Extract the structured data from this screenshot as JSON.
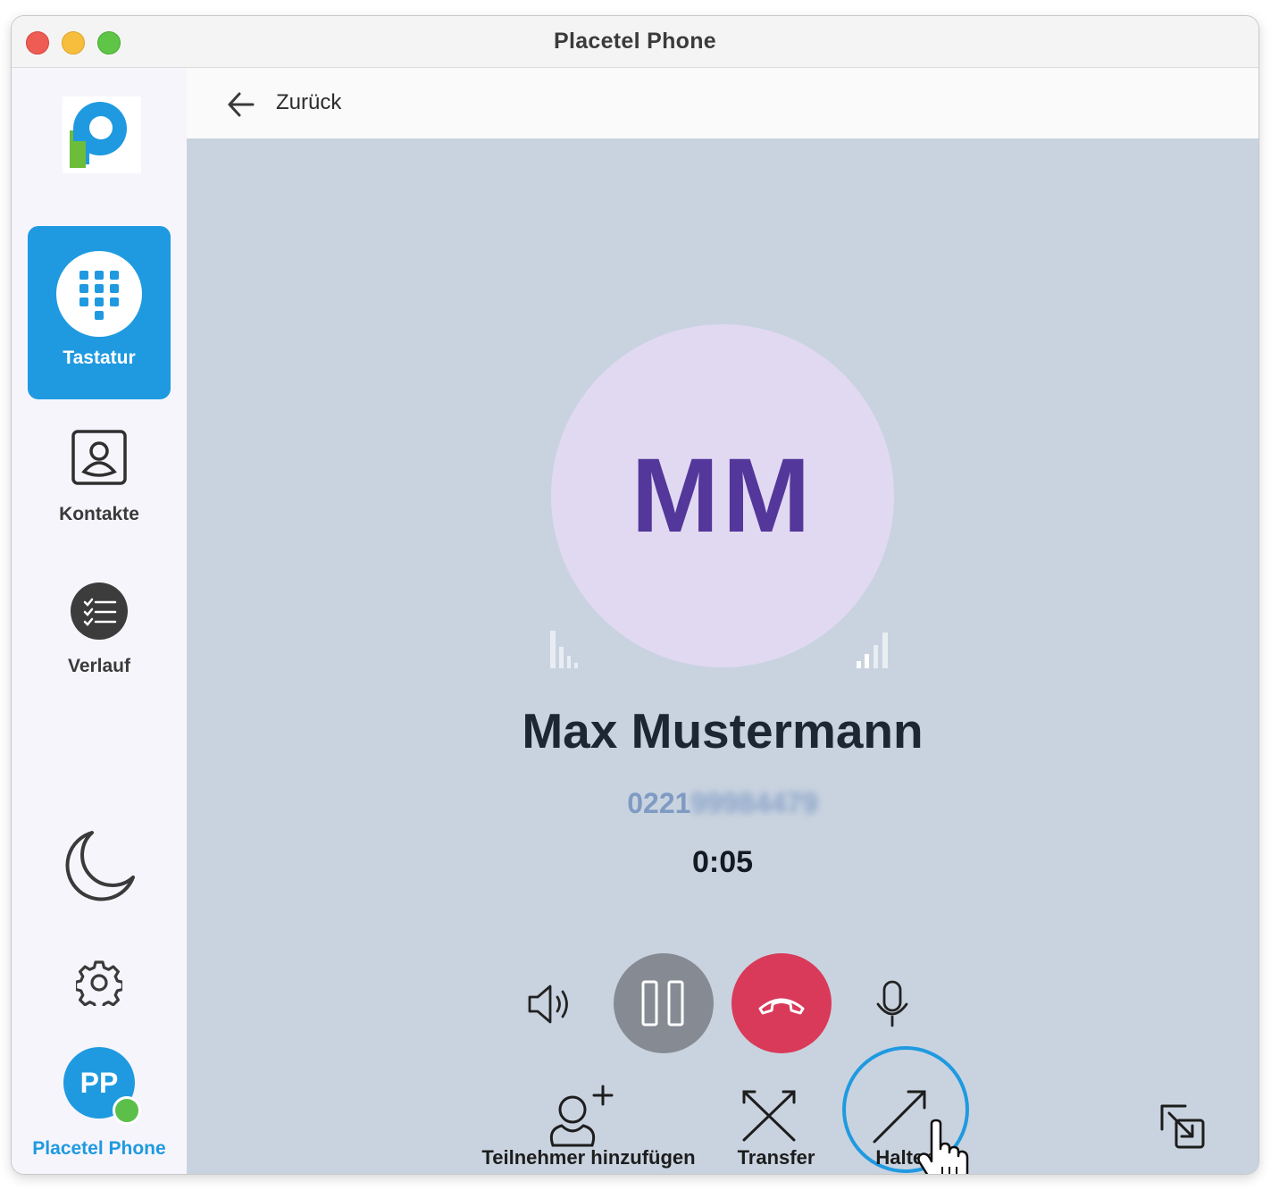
{
  "window": {
    "title": "Placetel Phone"
  },
  "sidebar": {
    "logo_icon": "placetel-logo",
    "items": [
      {
        "label": "Tastatur",
        "icon": "dialpad-icon",
        "active": true
      },
      {
        "label": "Kontakte",
        "icon": "contact-card-icon",
        "active": false
      },
      {
        "label": "Verlauf",
        "icon": "history-list-icon",
        "active": false
      }
    ],
    "dark_mode_icon": "moon-icon",
    "settings_icon": "gear-icon",
    "user": {
      "initials": "PP",
      "name": "Placetel Phone",
      "status": "online"
    }
  },
  "header": {
    "back_label": "Zurück",
    "back_icon": "arrow-left-icon"
  },
  "call": {
    "avatar_initials": "MM",
    "caller_name": "Max Mustermann",
    "number_visible": "0221",
    "number_blurred": "99984479",
    "duration": "0:05"
  },
  "controls": {
    "speaker_icon": "speaker-icon",
    "hold_icon": "pause-icon",
    "hangup_icon": "hangup-icon",
    "mic_icon": "microphone-icon"
  },
  "actions": [
    {
      "label": "Teilnehmer hinzufügen",
      "icon": "add-participant-icon"
    },
    {
      "label": "Transfer",
      "icon": "transfer-icon"
    },
    {
      "label": "Halten",
      "icon": "hold-arrow-icon"
    }
  ],
  "colors": {
    "accent": "#1f9ae0",
    "avatar_bg": "#e1d9f2",
    "avatar_text": "#54379a",
    "hangup": "#d93a5a",
    "hold_btn": "#868b93",
    "call_bg": "#c9d3df",
    "online": "#5cbf4a"
  }
}
